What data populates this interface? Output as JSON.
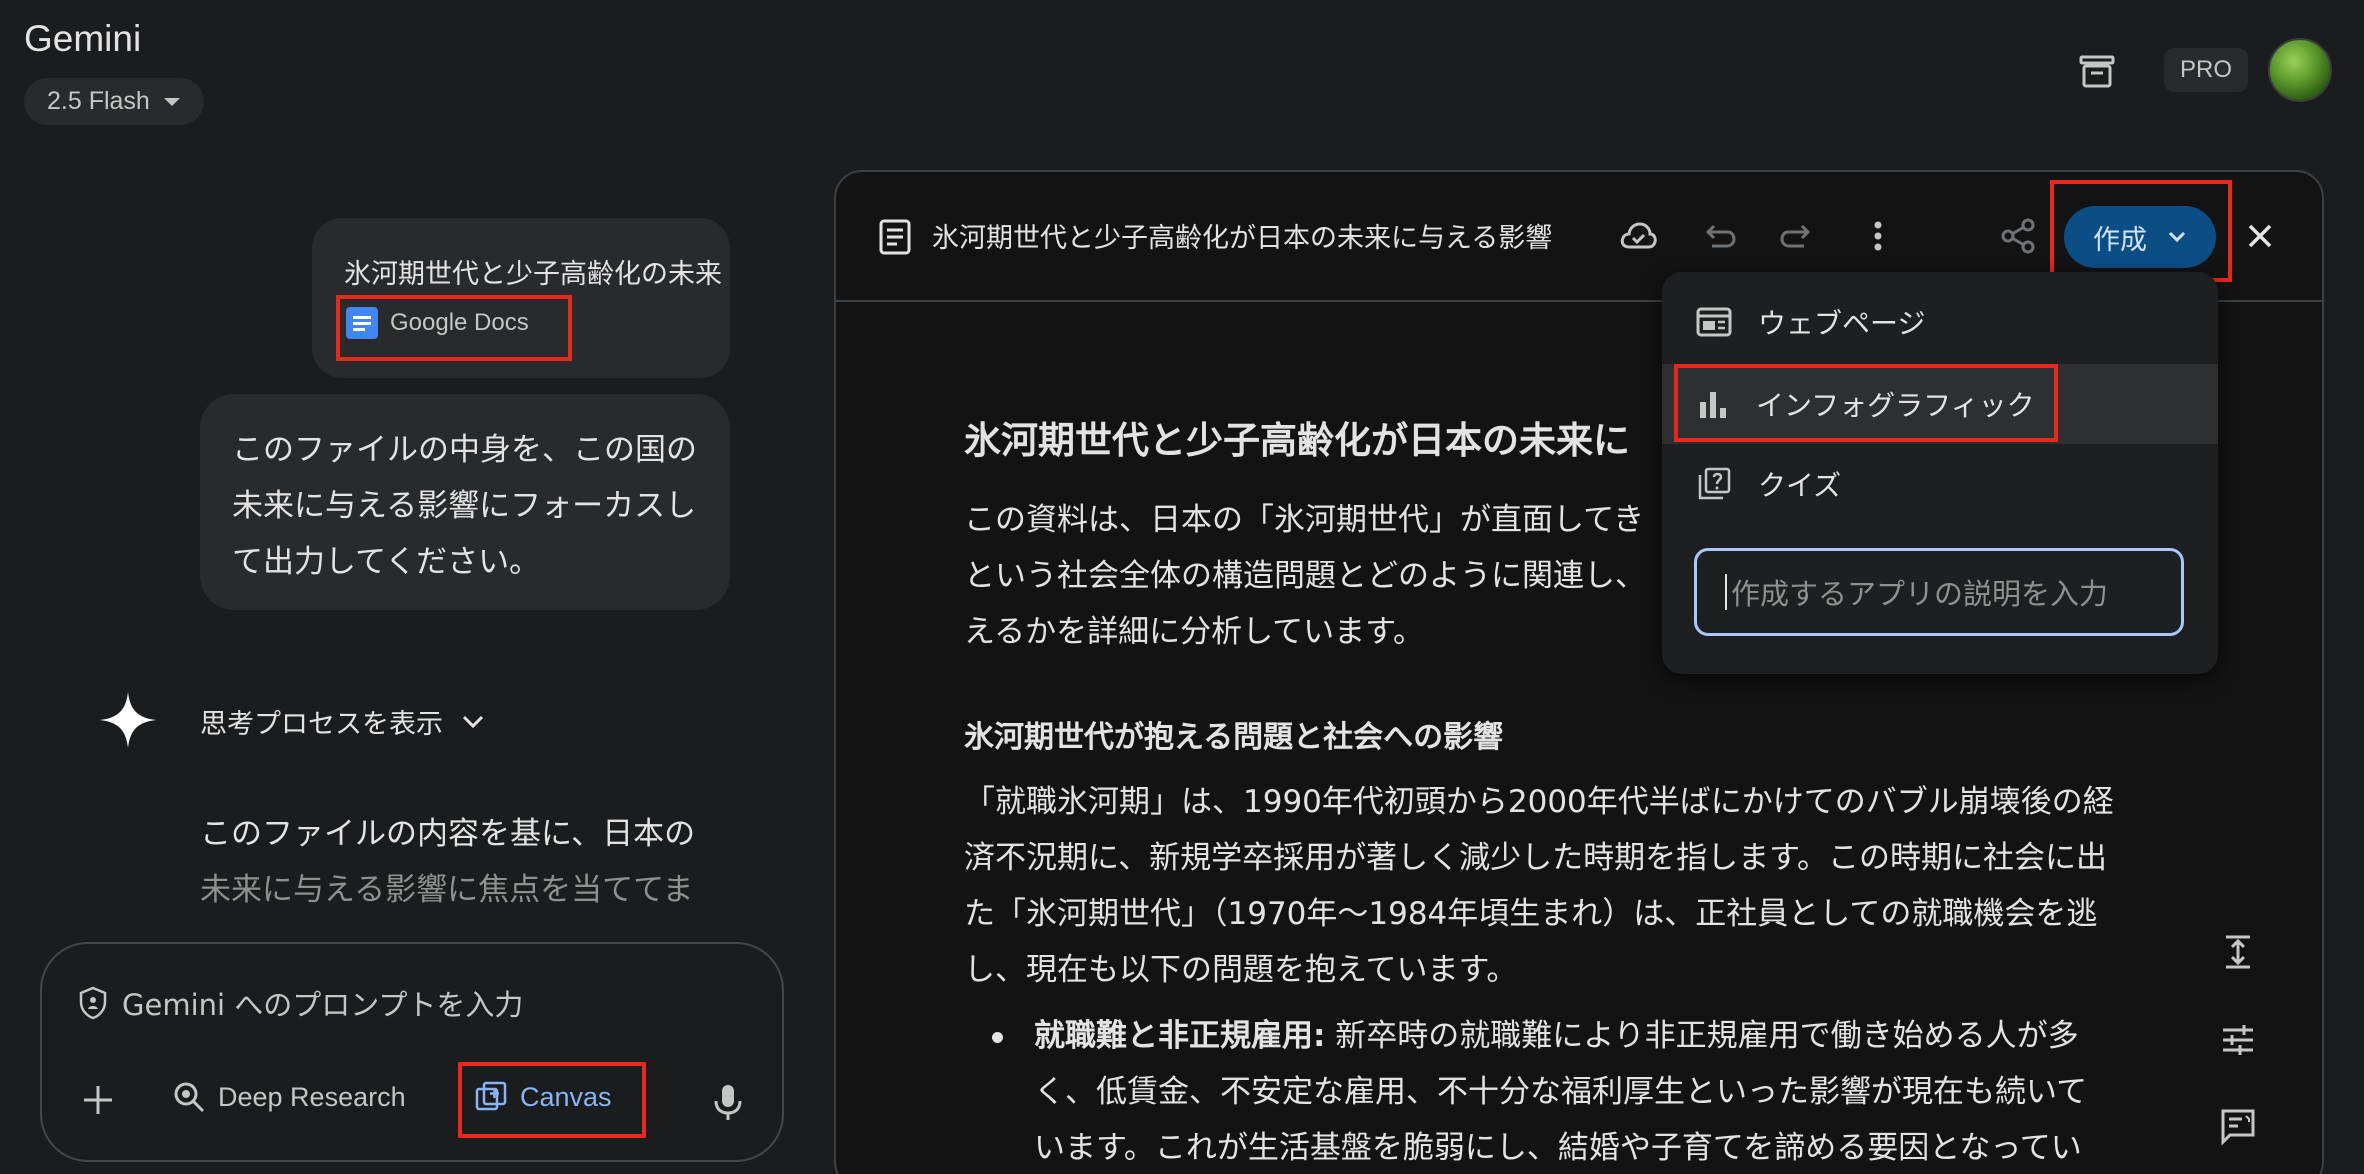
{
  "header": {
    "app_title": "Gemini",
    "model_label": "2.5 Flash",
    "pro_badge": "PRO"
  },
  "chat": {
    "user_message_1": {
      "text": "氷河期世代と少子高齢化の未来",
      "attachment_label": "Google Docs"
    },
    "user_message_2": "このファイルの中身を、この国の未来に与える影響にフォーカスして出力してください。",
    "thinking_toggle": "思考プロセスを表示",
    "reply_line_1": "このファイルの内容を基に、日本の",
    "reply_line_2": "未来に与える影響に焦点を当ててま"
  },
  "prompt": {
    "placeholder": "Gemini へのプロンプトを入力",
    "deep_research_label": "Deep Research",
    "canvas_label": "Canvas"
  },
  "canvas": {
    "title": "氷河期世代と少子高齢化が日本の未来に与える影響",
    "create_button": "作成",
    "document": {
      "heading": "氷河期世代と少子高齢化が日本の未来に",
      "intro_line_1": "この資料は、日本の「氷河期世代」が直面してき",
      "intro_line_2": "という社会全体の構造問題とどのように関連し、",
      "intro_line_3": "えるかを詳細に分析しています。",
      "section_heading": "氷河期世代が抱える問題と社会への影響",
      "para_line_1": "「就職氷河期」は、1990年代初頭から2000年代半ばにかけてのバブル崩壊後の経",
      "para_line_2": "済不況期に、新規学卒採用が著しく減少した時期を指します。この時期に社会に出",
      "para_line_3": "た「氷河期世代」（1970年〜1984年頃生まれ）は、正社員としての就職機会を逃",
      "para_line_4": "し、現在も以下の問題を抱えています。",
      "bullet_bold": "就職難と非正規雇用:",
      "bullet_line_1": " 新卒時の就職難により非正規雇用で働き始める人が多",
      "bullet_line_2": "く、低賃金、不安定な雇用、不十分な福利厚生といった影響が現在も続いて",
      "bullet_line_3": "います。これが生活基盤を脆弱にし、結婚や子育てを諦める要因となってい"
    }
  },
  "create_menu": {
    "items": [
      "ウェブページ",
      "インフォグラフィック",
      "クイズ"
    ],
    "input_placeholder": "作成するアプリの説明を入力"
  },
  "colors": {
    "background": "#1b1c1d",
    "accent_blue": "#8ab4f8",
    "create_button": "#0b4e86",
    "highlight_red": "#e8281b"
  }
}
